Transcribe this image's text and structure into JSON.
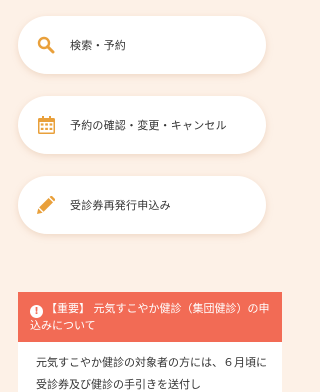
{
  "menu": [
    {
      "label": "検索・予約",
      "icon": "search-icon"
    },
    {
      "label": "予約の確認・変更・キャンセル",
      "icon": "calendar-icon"
    },
    {
      "label": "受診券再発行申込み",
      "icon": "pencil-icon"
    }
  ],
  "notice": {
    "title": "【重要】 元気すこやか健診（集団健診）の申込みについて",
    "body": "元気すこやか健診の対象者の方には、６月頃に受診券及び健診の手引きを送付し"
  },
  "colors": {
    "accent": "#e9a03b",
    "notice_header": "#f26b55",
    "background": "#fdf1e7"
  }
}
